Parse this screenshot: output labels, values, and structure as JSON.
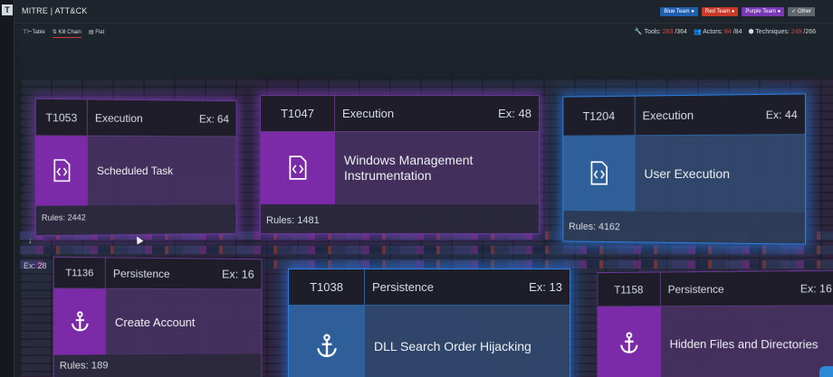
{
  "app": {
    "logo_letter": "T",
    "title": "MITRE | ATT&CK"
  },
  "teams": [
    {
      "label": "Blue Team",
      "color": "#1f5fb0"
    },
    {
      "label": "Red Team",
      "color": "#c83a2a"
    },
    {
      "label": "Purple Team",
      "color": "#7a37b5"
    },
    {
      "label": "Other",
      "color": "#5f666e"
    }
  ],
  "tabs": [
    {
      "label": "Table",
      "active": false
    },
    {
      "label": "Kill Chain",
      "active": true
    },
    {
      "label": "Flat",
      "active": false
    }
  ],
  "stats": {
    "tools_label": "Tools:",
    "tools_value": "283",
    "tools_total": "/364",
    "actors_label": "Actors:",
    "actors_value": "84",
    "actors_total": "/84",
    "techniques_label": "Techniques:",
    "techniques_value": "249",
    "techniques_total": "/266"
  },
  "side": {
    "ex_label": "Ex: 28",
    "arrow": "↓"
  },
  "cards": [
    {
      "id": "T1053",
      "tactic": "Execution",
      "ex": "Ex: 64",
      "name": "Scheduled Task",
      "rules": "Rules: 2442",
      "icon": "script-file-icon",
      "team": "purple"
    },
    {
      "id": "T1047",
      "tactic": "Execution",
      "ex": "Ex: 48",
      "name": "Windows Management Instrumentation",
      "rules": "Rules: 1481",
      "icon": "script-file-icon",
      "team": "purple"
    },
    {
      "id": "T1204",
      "tactic": "Execution",
      "ex": "Ex: 44",
      "name": "User Execution",
      "rules": "Rules: 4162",
      "icon": "script-file-icon",
      "team": "blue"
    },
    {
      "id": "T1136",
      "tactic": "Persistence",
      "ex": "Ex: 16",
      "name": "Create Account",
      "rules": "Rules: 189",
      "icon": "anchor-icon",
      "team": "none"
    },
    {
      "id": "T1038",
      "tactic": "Persistence",
      "ex": "Ex: 13",
      "name": "DLL Search Order Hijacking",
      "rules": "",
      "icon": "anchor-icon",
      "team": "blue"
    },
    {
      "id": "T1158",
      "tactic": "Persistence",
      "ex": "Ex: 16",
      "name": "Hidden Files and Directories",
      "rules": "",
      "icon": "anchor-icon",
      "team": "none"
    }
  ]
}
